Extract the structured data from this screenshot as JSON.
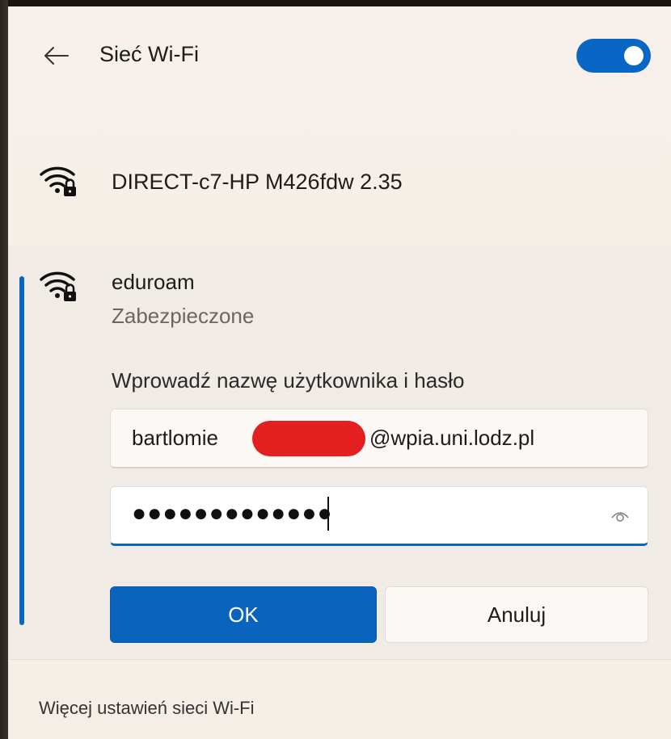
{
  "header": {
    "title": "Sieć Wi-Fi",
    "wifi_toggle_on": true
  },
  "networks": [
    {
      "ssid": "DIRECT-c7-HP M426fdw 2.35",
      "secured": true,
      "icon": "wifi-lock-icon"
    },
    {
      "ssid": "eduroam",
      "status": "Zabezpieczone",
      "secured": true,
      "icon": "wifi-lock-icon",
      "expanded": true,
      "prompt": "Wprowadź nazwę użytkownika i hasło",
      "username_visible_start": "bartlomie",
      "username_visible_end": "@wpia.uni.lodz.pl",
      "password_mask": "●●●●●●●●●●●●●",
      "ok_label": "OK",
      "cancel_label": "Anuluj"
    }
  ],
  "footer": {
    "more_settings_label": "Więcej ustawień sieci Wi-Fi"
  },
  "colors": {
    "accent": "#0a66c2",
    "redaction": "#e41f1f"
  }
}
